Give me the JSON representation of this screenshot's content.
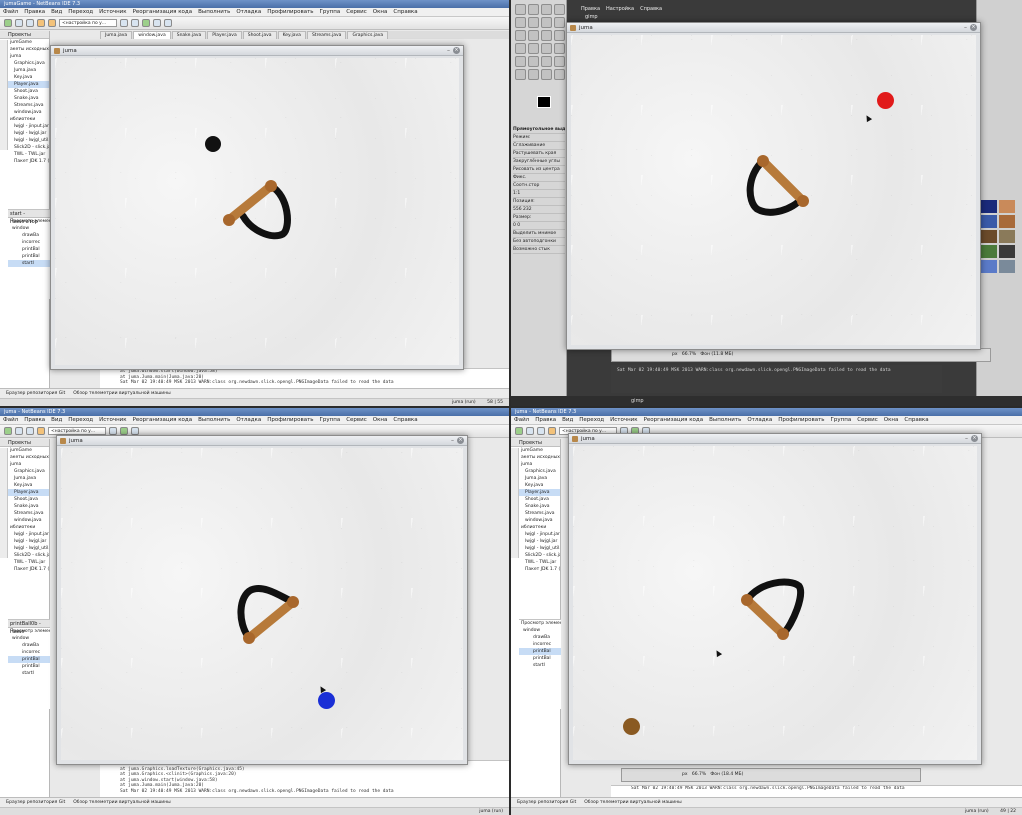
{
  "ide": {
    "title_q1": "jumaGame - NetBeans IDE 7.3",
    "title_q3": "juma - NetBeans IDE 7.3",
    "title_q4": "juma - NetBeans IDE 7.3",
    "menu": [
      "Файл",
      "Правка",
      "Вид",
      "Переход",
      "Источник",
      "Реорганизация кода",
      "Выполнить",
      "Отладка",
      "Профилировать",
      "Группа",
      "Сервис",
      "Окна",
      "Справка"
    ],
    "config_combo": "<настройка по у...",
    "tabs": [
      "Juma.java",
      "window.java",
      "Snake.java",
      "Player.java",
      "Shoot.java",
      "Key.java",
      "Streams.java",
      "Graphics.java"
    ],
    "projects_label": "Проекты",
    "tree": [
      "jumGame",
      "акеты исходных",
      "juma",
      "Graphics.java",
      "Juma.java",
      "Key.java",
      "Player.java",
      "Shoot.java",
      "Snake.java",
      "Streams.java",
      "window.java",
      "иблиотеки",
      "lwjgl - jinput.jar",
      "lwjgl - lwjgl.jar",
      "lwjgl - lwjgl_util.ja",
      "Slick2D - slick.jar",
      "TWL - TWL.jar",
      "Пакет JDK 1.7 (Def"
    ],
    "nav_header_q1": "start - Навигатор",
    "nav_header_q3": "printBall0b - Навиг",
    "nav_browse": "Просмотр элемент",
    "nav_items": [
      "window",
      "drawBa",
      "incorrec",
      "printBal",
      "printBal",
      "startI"
    ],
    "console_q1": [
      "at juma.window.start(window.java:58)",
      "at juma.Juma.main(Juma.java:20)",
      "Sat Mar 02 19:40:49 MSK 2013 WARN:class org.newdawn.slick.opengl.PNGImageData failed to read the data"
    ],
    "console_q3": [
      "at org.newdawn.slick.opengl.TextureLoader.getTexture(TextureLoader.java:24)",
      "at juma.Graphics.loadTexture(Graphics.java:45)",
      "at juma.Graphics.<clinit>(Graphics.java:20)",
      "at juma.window.start(window.java:58)",
      "at juma.Juma.main(Juma.java:20)",
      "Sat Mar 02 19:40:49 MSK 2013 WARN:class org.newdawn.slick.opengl.PNGImageData failed to read the data"
    ],
    "bottom_tabs": [
      "Браузер репозитория Git",
      "Обзор телеметрии виртуальной машины"
    ],
    "status_q1": "juma (run)",
    "caret_q1": "58 | 55",
    "caret_q4": "49 | 22"
  },
  "game": {
    "window_title": "juma",
    "close_glyph": "×",
    "minimize_glyph": "–"
  },
  "gimp": {
    "menu": [
      "Правка",
      "Настройка",
      "Справка"
    ],
    "label": "gimp",
    "tool_options_title": "Прямоугольное выделение",
    "options": [
      "Режим:",
      "Сглаживание",
      "Растушевать края",
      "Закруглённые углы",
      "Рисовать из центра",
      "Фикс.",
      "Соотн.стор",
      "1:1",
      "Позиция:",
      "Размер:",
      "Выделить мнимое",
      "Без автоподгонки",
      "Возможно стык"
    ],
    "position": "556  232",
    "size": "0    0",
    "status_zoom": "66.7%",
    "status_unit": "px",
    "status_text": "Фон (11.8 МБ)",
    "task_label": "gimp",
    "console": "Sat Mar 02 19:40:49 MSK 2013 WARN:class org.newdawn.slick.opengl.PNGImageData failed to read the data"
  },
  "q4": {
    "status_zoom": "66.7%",
    "status_unit": "px",
    "status_text": "Фон (18.4 МБ)"
  },
  "colors": {
    "slingshot_band": "#111111",
    "slingshot_wood": "#b77a3a",
    "ball_black": "#111111",
    "ball_red": "#e11a1a",
    "ball_blue": "#1a2fd6",
    "ball_brown": "#8a5a22"
  }
}
